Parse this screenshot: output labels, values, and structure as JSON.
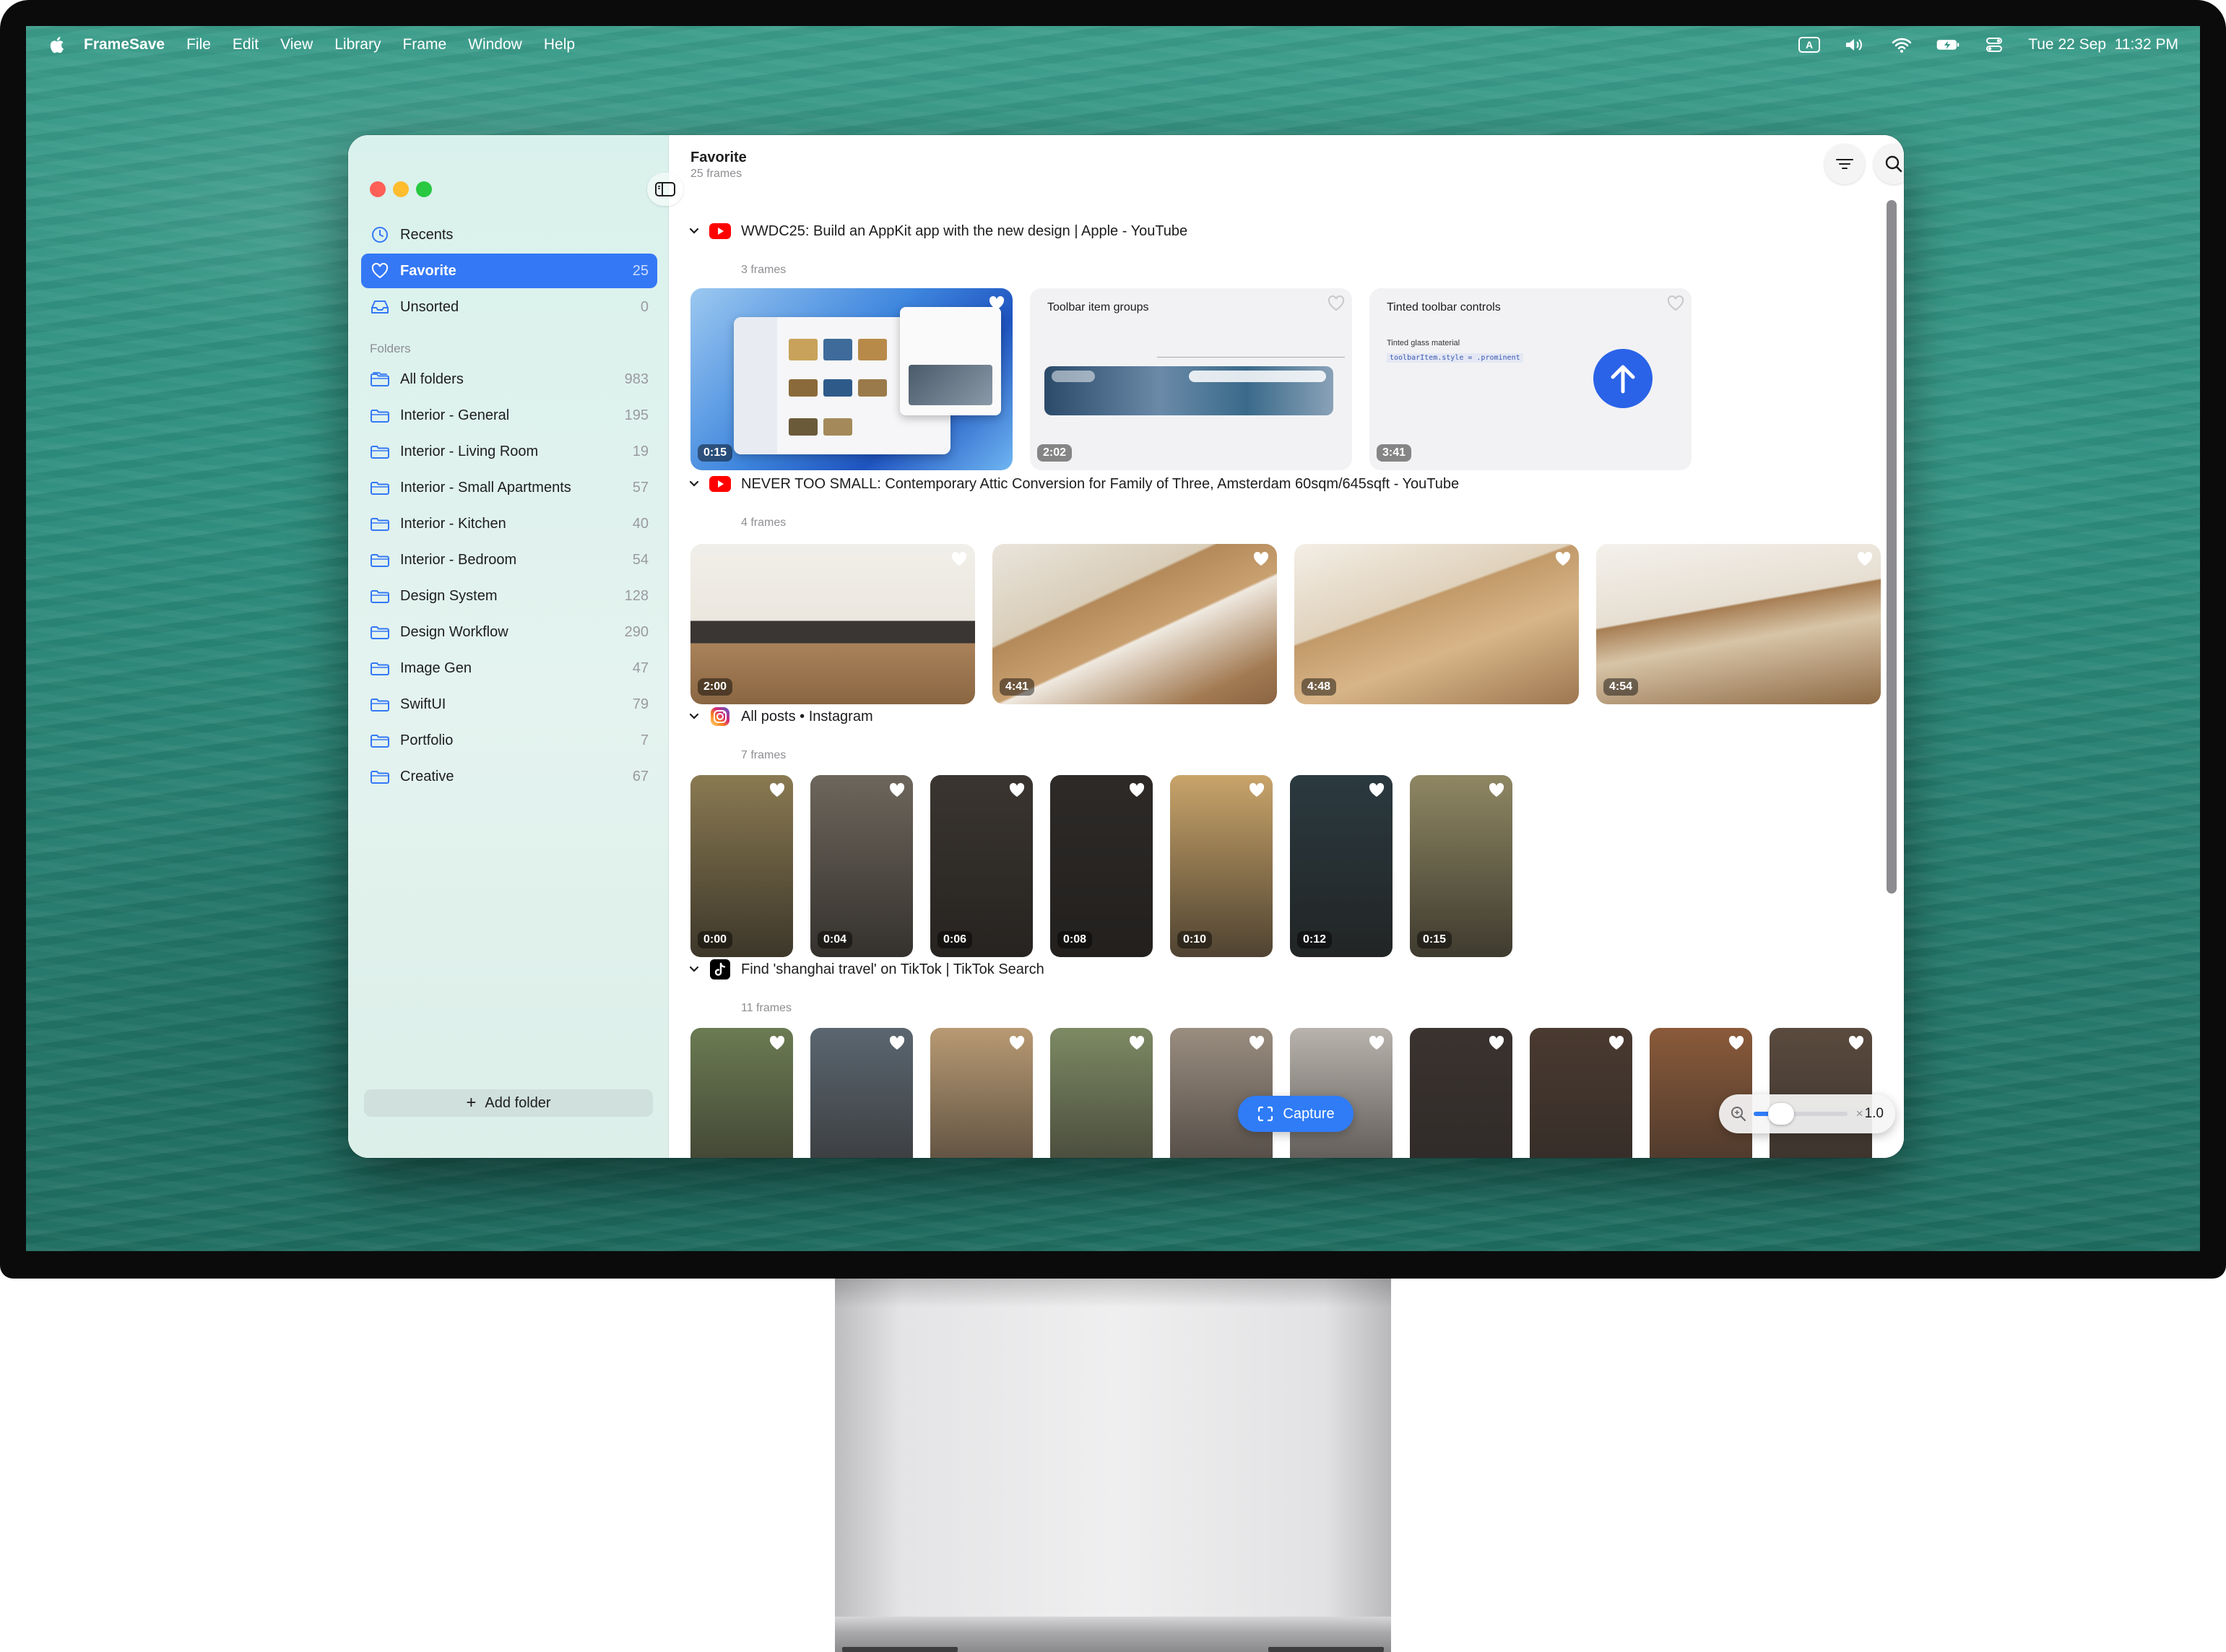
{
  "menubar": {
    "app_name": "FrameSave",
    "menus": [
      "File",
      "Edit",
      "View",
      "Library",
      "Frame",
      "Window",
      "Help"
    ],
    "datetime": "Tue 22 Sep  11:32 PM"
  },
  "sidebar": {
    "nav": [
      {
        "label": "Recents",
        "count": "",
        "icon": "clock-icon"
      },
      {
        "label": "Favorite",
        "count": "25",
        "icon": "heart-icon",
        "active": true
      },
      {
        "label": "Unsorted",
        "count": "0",
        "icon": "tray-icon"
      }
    ],
    "folders_label": "Folders",
    "folders": [
      {
        "label": "All folders",
        "count": "983",
        "icon": "stacked-folders-icon"
      },
      {
        "label": "Interior - General",
        "count": "195"
      },
      {
        "label": "Interior - Living Room",
        "count": "19"
      },
      {
        "label": "Interior - Small Apartments",
        "count": "57"
      },
      {
        "label": "Interior - Kitchen",
        "count": "40"
      },
      {
        "label": "Interior - Bedroom",
        "count": "54"
      },
      {
        "label": "Design System",
        "count": "128"
      },
      {
        "label": "Design Workflow",
        "count": "290"
      },
      {
        "label": "Image Gen",
        "count": "47"
      },
      {
        "label": "SwiftUI",
        "count": "79"
      },
      {
        "label": "Portfolio",
        "count": "7"
      },
      {
        "label": "Creative",
        "count": "67"
      }
    ],
    "add_folder_label": "Add folder"
  },
  "main": {
    "title": "Favorite",
    "subtitle": "25 frames",
    "groups": [
      {
        "source": "youtube",
        "title": "WWDC25: Build an AppKit app with the new design | Apple - YouTube",
        "count": "3 frames",
        "frames": [
          {
            "duration": "0:15",
            "style": "appkit"
          },
          {
            "duration": "2:02",
            "style": "toolbar",
            "label": "Toolbar item groups"
          },
          {
            "duration": "3:41",
            "style": "tinted",
            "label": "Tinted toolbar controls",
            "sublabel": "Tinted glass material",
            "code": "toolbarItem.style = .prominent"
          }
        ]
      },
      {
        "source": "youtube",
        "title": "NEVER TOO SMALL: Contemporary Attic Conversion for Family of Three, Amsterdam 60sqm/645sqft - YouTube",
        "count": "4 frames",
        "frames": [
          {
            "duration": "2:00"
          },
          {
            "duration": "4:41"
          },
          {
            "duration": "4:48"
          },
          {
            "duration": "4:54"
          }
        ]
      },
      {
        "source": "instagram",
        "title": "All posts • Instagram",
        "count": "7 frames",
        "frames": [
          {
            "duration": "0:00",
            "color": "#8a7a52"
          },
          {
            "duration": "0:04",
            "color": "#6d665c"
          },
          {
            "duration": "0:06",
            "color": "#3a3530"
          },
          {
            "duration": "0:08",
            "color": "#2d2a28"
          },
          {
            "duration": "0:10",
            "color": "#c9a46a"
          },
          {
            "duration": "0:12",
            "color": "#2b3a40"
          },
          {
            "duration": "0:15",
            "color": "#8f8763"
          }
        ]
      },
      {
        "source": "tiktok",
        "title": "Find 'shanghai travel' on TikTok | TikTok Search",
        "count": "11 frames",
        "frames": [
          {
            "color": "#6b7b52"
          },
          {
            "color": "#5a6670"
          },
          {
            "color": "#b89a73"
          },
          {
            "color": "#7d8a64"
          },
          {
            "color": "#9a8d80"
          },
          {
            "color": "#b8b3ac"
          },
          {
            "color": "#3a3330"
          },
          {
            "color": "#4a3a30"
          },
          {
            "color": "#8a5a3a"
          },
          {
            "color": "#5a4a3e"
          }
        ]
      }
    ],
    "capture_label": "Capture",
    "zoom": {
      "prefix": "×",
      "value": "1.0",
      "level": 0.15
    }
  },
  "colors": {
    "accent": "#3478f6",
    "youtube": "#ff0000"
  }
}
